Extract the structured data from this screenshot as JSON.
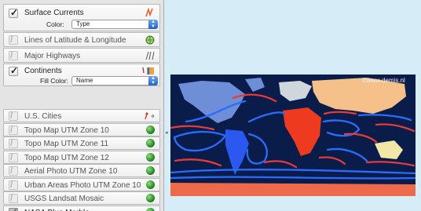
{
  "layers": [
    {
      "id": "surface-currents",
      "label": "Surface Currents",
      "checked": true,
      "sub": {
        "label": "Color:",
        "value": "Type"
      },
      "icon": "currents-icon"
    },
    {
      "id": "lat-long",
      "label": "Lines of Latitude & Longitude",
      "checked": false,
      "icon": "globe-grid-icon"
    },
    {
      "id": "highways",
      "label": "Major Highways",
      "checked": false,
      "icon": "highway-lines-icon"
    },
    {
      "id": "continents",
      "label": "Continents",
      "checked": true,
      "sub": {
        "label": "Fill Color:",
        "value": "Name"
      },
      "icon": "paint-tools-icon"
    },
    {
      "id": "us-cities",
      "label": "U.S. Cities",
      "checked": false,
      "icon": "pin-icon"
    },
    {
      "id": "utm10",
      "label": "Topo Map UTM Zone 10",
      "checked": false,
      "icon": "sphere-icon"
    },
    {
      "id": "utm11",
      "label": "Topo Map UTM Zone 11",
      "checked": false,
      "icon": "sphere-icon"
    },
    {
      "id": "utm12",
      "label": "Topo Map UTM Zone 12",
      "checked": false,
      "icon": "sphere-icon"
    },
    {
      "id": "aerial10",
      "label": "Aerial Photo UTM Zone 10",
      "checked": false,
      "icon": "sphere-icon"
    },
    {
      "id": "urban10",
      "label": "Urban Areas Photo UTM Zone 10",
      "checked": false,
      "icon": "sphere-icon"
    },
    {
      "id": "landsat",
      "label": "USGS Landsat Mosaic",
      "checked": false,
      "icon": "sphere-icon"
    },
    {
      "id": "bluemarble",
      "label": "NASA Blue Marble",
      "checked": true,
      "icon": "sphere-icon"
    }
  ],
  "map": {
    "watermark": "©www.demis.nl",
    "colors": {
      "ocean": "#0a1d4a",
      "currents": "#2a6cff",
      "warm_currents": "#e43a3a",
      "antarctica": "#ee6a4a"
    }
  }
}
